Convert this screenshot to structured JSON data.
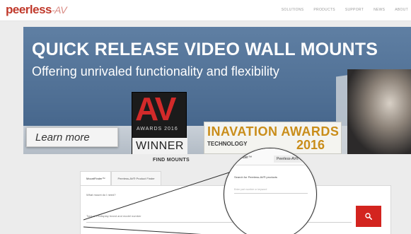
{
  "header": {
    "logo_main": "peerless",
    "logo_suffix": "-AV",
    "nav": [
      "SOLUTIONS",
      "PRODUCTS",
      "SUPPORT",
      "NEWS",
      "ABOUT"
    ]
  },
  "hero": {
    "title": "QUICK RELEASE VIDEO WALL MOUNTS",
    "subtitle": "Offering unrivaled functionality and flexibility",
    "learn_more": "Learn more",
    "av_badge": {
      "letters": "AV",
      "awards": "AWARDS 2016",
      "winner": "WINNER"
    },
    "inavation_badge": {
      "text": "INAVATION AWARDS",
      "year": "2016",
      "tech": "TECHNOLOGY"
    }
  },
  "finder": {
    "title": "FIND MOUNTS",
    "tabs": [
      "MountFinder™",
      "Peerless-AV® Product Finder"
    ],
    "question": "What mount do I need?",
    "search_placeholder": "Type a TV/display brand and model number",
    "search_button_icon": "search-icon"
  },
  "magnifier": {
    "tab1": "MountFinder™",
    "tab2": "Peerless-AV® Product",
    "label": "Search for Peerless-AV® products",
    "input_hint": "Enter part number or keyword"
  },
  "colors": {
    "brand": "#c0392b",
    "hero_blue": "#4f6f94",
    "search_red": "#d3241f"
  }
}
